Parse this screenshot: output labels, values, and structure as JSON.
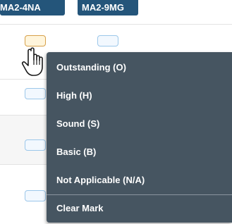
{
  "header": {
    "tags": [
      "MA2-4NA",
      "MA2-9MG"
    ]
  },
  "grid": {
    "mark_boxes": [
      "col-1-row-1-hover",
      "col-2-row-1",
      "col-1-row-2",
      "col-1-row-3",
      "col-1-row-4"
    ]
  },
  "menu": {
    "items": [
      {
        "label": "Outstanding (O)"
      },
      {
        "label": "High (H)"
      },
      {
        "label": "Sound (S)"
      },
      {
        "label": "Basic (B)"
      },
      {
        "label": "Not Applicable (N/A)"
      },
      {
        "label": "Clear Mark"
      }
    ]
  },
  "cursor": {
    "icon": "hand-pointer-icon"
  },
  "colors": {
    "tag_bg": "#24557a",
    "menu_bg": "#465561",
    "mark_border": "#9cc7ea",
    "mark_hover_border": "#d6a04a"
  }
}
